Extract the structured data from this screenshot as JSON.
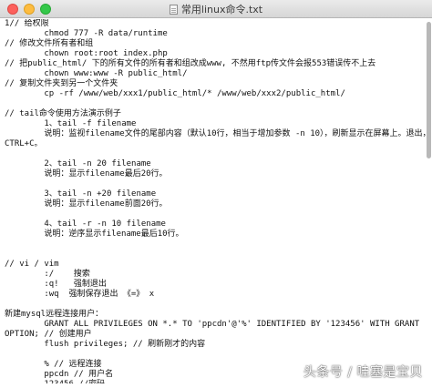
{
  "window": {
    "title": "常用linux命令.txt",
    "doc_icon": "text-document-icon"
  },
  "lines": [
    "1// 给权限",
    "        chmod 777 -R data/runtime",
    "// 修改文件所有者和组",
    "        chown root:root index.php",
    "// 把public_html/ 下的所有文件的所有者和组改成www, 不然用ftp传文件会报553错误传不上去",
    "        chown www:www -R public_html/",
    "// 复制文件夹到另一个文件夹",
    "        cp -rf /www/web/xxx1/public_html/* /www/web/xxx2/public_html/",
    "",
    "// tail命令使用方法演示例子",
    "        1、tail -f filename",
    "        说明：监视filename文件的尾部内容（默认10行，相当于增加参数 -n 10），刷新显示在屏幕上。退出，按下",
    "CTRL+C。",
    "",
    "        2、tail -n 20 filename",
    "        说明：显示filename最后20行。",
    "",
    "        3、tail -n +20 filename",
    "        说明：显示filename前面20行。",
    "",
    "        4、tail -r -n 10 filename",
    "        说明：逆序显示filename最后10行。",
    "",
    "",
    "// vi / vim",
    "        :/    搜索",
    "        :q!   强制退出",
    "        :wq  强制保存退出 《=》 x",
    "",
    "新建mysql远程连接用户：",
    "        GRANT ALL PRIVILEGES ON *.* TO 'ppcdn'@'%' IDENTIFIED BY '123456' WITH GRANT",
    "OPTION; // 创建用户",
    "        flush privileges; // 刷新刚才的内容",
    "",
    "        % // 远程连接",
    "        ppcdn // 用户名",
    "        123456 //密码"
  ],
  "watermark": "头条号 / 哇塞是宝贝"
}
